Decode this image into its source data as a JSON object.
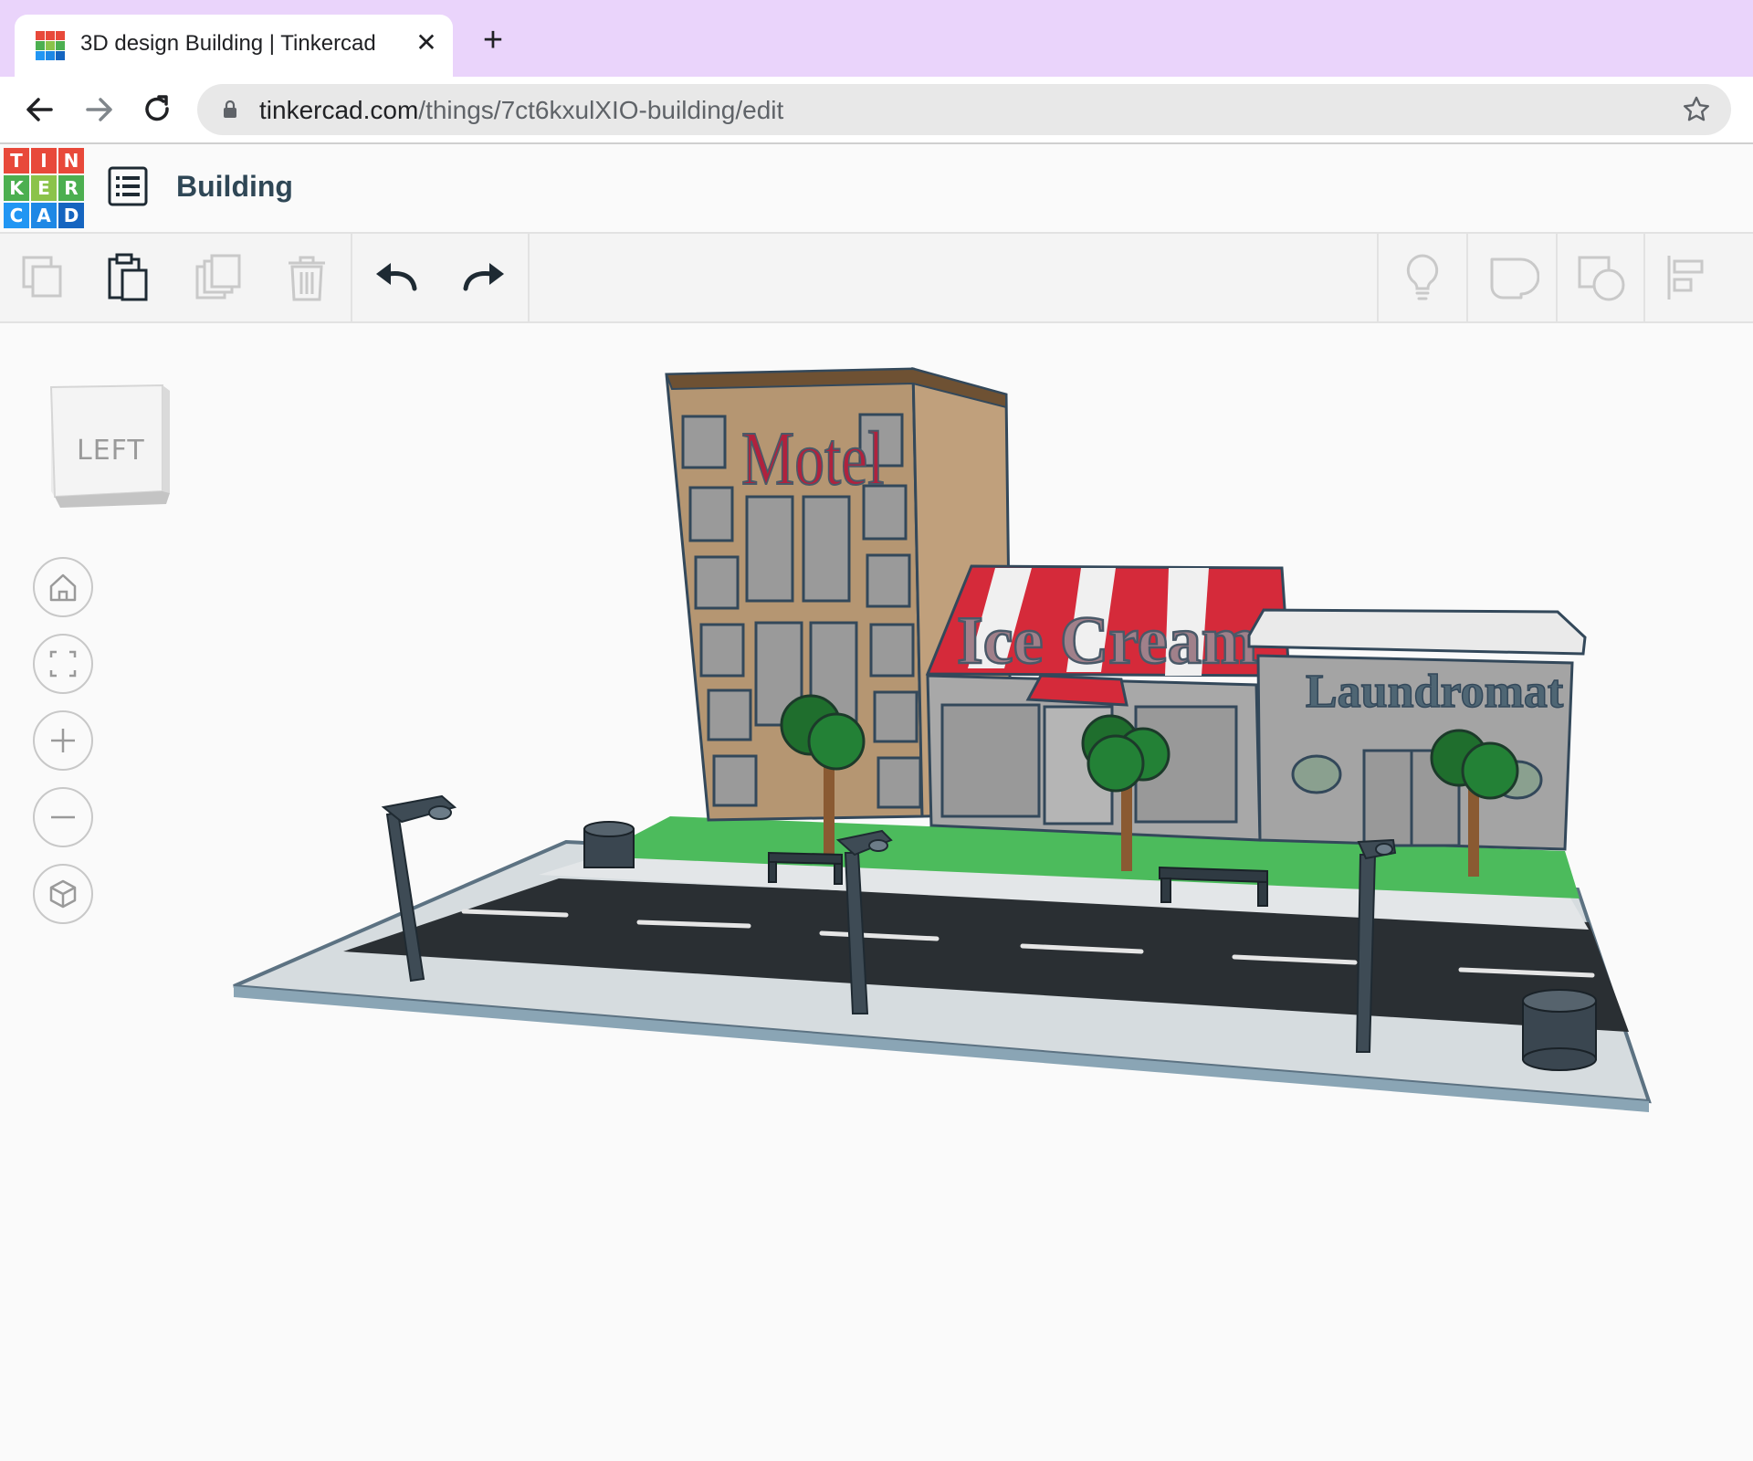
{
  "browser": {
    "tab": {
      "title": "3D design Building | Tinkercad",
      "close_icon": "close-icon",
      "favicon": "tinkercad-favicon"
    },
    "new_tab_icon": "plus-icon",
    "nav": {
      "back_icon": "arrow-left-icon",
      "forward_icon": "arrow-right-icon",
      "reload_icon": "reload-icon"
    },
    "url": {
      "host": "tinkercad.com",
      "path": "/things/7ct6kxulXIO-building/edit",
      "lock_icon": "lock-icon",
      "bookmark_icon": "star-icon"
    }
  },
  "app": {
    "logo_letters": [
      "T",
      "I",
      "N",
      "K",
      "E",
      "R",
      "C",
      "A",
      "D"
    ],
    "logo_colors": [
      "#e8493a",
      "#e8493a",
      "#e8493a",
      "#4caf50",
      "#8bc34a",
      "#4caf50",
      "#2196f3",
      "#1e88e5",
      "#1565c0"
    ],
    "design_list_icon": "list-icon",
    "design_name": "Building"
  },
  "toolbar": {
    "left_tools": [
      {
        "name": "copy",
        "icon": "copy-icon",
        "enabled": false
      },
      {
        "name": "paste",
        "icon": "paste-icon",
        "enabled": true
      },
      {
        "name": "duplicate",
        "icon": "duplicate-icon",
        "enabled": false
      },
      {
        "name": "delete",
        "icon": "trash-icon",
        "enabled": false
      },
      {
        "name": "undo",
        "icon": "undo-icon",
        "enabled": true
      },
      {
        "name": "redo",
        "icon": "redo-icon",
        "enabled": true
      }
    ],
    "right_tools": [
      {
        "name": "notes",
        "icon": "lightbulb-icon",
        "enabled": false
      },
      {
        "name": "group",
        "icon": "group-icon",
        "enabled": false
      },
      {
        "name": "ungroup",
        "icon": "ungroup-icon",
        "enabled": false
      },
      {
        "name": "align",
        "icon": "align-icon",
        "enabled": false
      }
    ]
  },
  "workspace": {
    "viewcube_label": "LEFT",
    "view_controls": [
      "home-view-icon",
      "fit-all-icon",
      "zoom-in-icon",
      "zoom-out-icon",
      "perspective-icon"
    ],
    "signs": {
      "motel": "Motel",
      "ice_cream": "Ice Cream",
      "laundromat": "Laundromat"
    },
    "colors": {
      "road": "#2a2f33",
      "grass": "#4cbb5c",
      "awning_red": "#d52a3a",
      "motel_wall": "#b59672",
      "shop_wall": "#a4a4a4"
    }
  }
}
